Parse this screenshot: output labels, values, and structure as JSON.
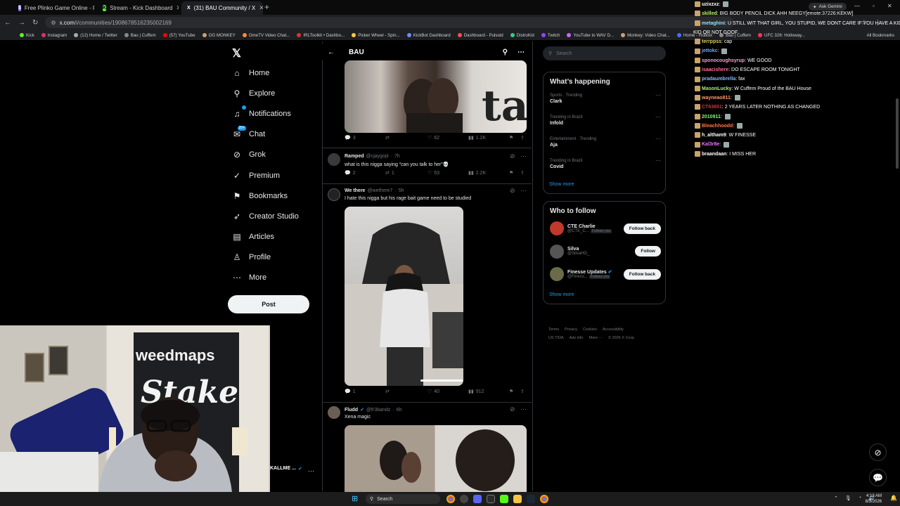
{
  "browser": {
    "tabs": [
      {
        "title": "Free Plinko Game Online - Play",
        "icon_color": "#8a6cff",
        "icon": "$"
      },
      {
        "title": "Stream - Kick Dashboard",
        "icon_color": "#53fc18",
        "icon": "K"
      },
      {
        "title": "(31) BAU Community / X",
        "icon_color": "#000000",
        "icon": "X"
      }
    ],
    "url_domain": "x.com",
    "url_path": "/i/communities/1908678516235002169",
    "bookmarks": [
      "Kick",
      "Instagram",
      "(12) Home / Twitter",
      "Bau | Cuffem",
      "(57) YouTube",
      "OG MONKEY",
      "OmeTV Video Chat...",
      "IRLToolkit • Dashbo...",
      "Picker Wheel - Spin...",
      "KickBot Dashboard",
      "Dashboard - Pulsoid",
      "DistroKid",
      "Twitch",
      "YouTube to WAV D...",
      "Monkey: Video Chat...",
      "Home - Roblox",
      "Bau | Cuffem",
      "UFC 326: Holloway..."
    ],
    "all_bookmarks": "All Bookmarks",
    "ask_gemini": "Ask Gemini"
  },
  "nav": {
    "items": [
      {
        "label": "Home",
        "icon": "home-icon",
        "glyph": "⌂"
      },
      {
        "label": "Explore",
        "icon": "search-icon",
        "glyph": "⚲"
      },
      {
        "label": "Notifications",
        "icon": "bell-icon",
        "glyph": "♫"
      },
      {
        "label": "Chat",
        "icon": "chat-icon",
        "glyph": "✉",
        "badge": "20+"
      },
      {
        "label": "Grok",
        "icon": "grok-icon",
        "glyph": "⊘"
      },
      {
        "label": "Premium",
        "icon": "premium-icon",
        "glyph": "✓"
      },
      {
        "label": "Bookmarks",
        "icon": "bookmark-icon",
        "glyph": "⚑"
      },
      {
        "label": "Creator Studio",
        "icon": "rocket-icon",
        "glyph": "➶"
      },
      {
        "label": "Articles",
        "icon": "article-icon",
        "glyph": "▤"
      },
      {
        "label": "Profile",
        "icon": "profile-icon",
        "glyph": "♙"
      },
      {
        "label": "More",
        "icon": "more-icon",
        "glyph": "⋯"
      }
    ],
    "post_label": "Post"
  },
  "feed": {
    "title": "BAU",
    "tweet0_stats": {
      "replies": "3",
      "likes": "62",
      "views": "1.2K"
    },
    "tweets": [
      {
        "name": "Ramped",
        "handle": "@cjaygojii",
        "time": "7h",
        "text": "what is this nigga saying “can you talk to her”💀",
        "replies": "2",
        "retweets": "1",
        "likes": "53",
        "views": "2.2K"
      },
      {
        "name": "We there",
        "handle": "@wethere7",
        "time": "5h",
        "text": "I hate this nigga but his rage bait game need to be studied",
        "replies": "1",
        "retweets": "",
        "likes": "40",
        "views": "912"
      },
      {
        "name": "Fludd",
        "handle": "@fr3bandz",
        "time": "6h",
        "text": "Xena magic"
      }
    ]
  },
  "right": {
    "search_placeholder": "Search",
    "whats_happening": "What’s happening",
    "trends": [
      {
        "context": "Sports · Trending",
        "name": "Clark"
      },
      {
        "context": "Trending in Brazil",
        "name": "Infold"
      },
      {
        "context": "Entertainment · Trending",
        "name": "Aja"
      },
      {
        "context": "Trending in Brazil",
        "name": "Covid"
      }
    ],
    "show_more": "Show more",
    "who_to_follow": "Who to follow",
    "follow": [
      {
        "name": "CTE Charlie",
        "handle": "@CTE_C...",
        "follows_you": "Follows you",
        "button": "Follow back",
        "color": "#c0392b"
      },
      {
        "name": "Silva",
        "handle": "@SilvaHG_",
        "follows_you": "",
        "button": "Follow",
        "color": "#555555"
      },
      {
        "name": "Finesse Updates",
        "handle": "@Finess...",
        "follows_you": "Follows you",
        "button": "Follow back",
        "color": "#6b6b4a"
      }
    ],
    "footer_line1": [
      "Terms",
      "Privacy",
      "Cookies",
      "Accessibility"
    ],
    "footer_line2": [
      "US TIDA",
      "Ads info",
      "More ···",
      "© 2026 X Corp."
    ]
  },
  "chat": {
    "lines": [
      {
        "user": "uzixzxz",
        "color": "#ffffff",
        "msg": "",
        "emote": true
      },
      {
        "user": "skilled",
        "color": "#b7f06c",
        "msg": "BIG BODY PENCIL DICK AHH NEEGY[emote:37226:KEKW]"
      },
      {
        "user": "metaghini",
        "color": "#8ee0ff",
        "msg": "U STILL WIT THAT GIRL, YOU STUPID, WE DONT CARE IF YOU HAVE A KID OR NOT GOOF"
      },
      {
        "user": "",
        "color": "#ffffff",
        "msg": "KID OR NOT GOOF"
      },
      {
        "user": "terrppss",
        "color": "#e0d060",
        "msg": "cap"
      },
      {
        "user": "jettokc",
        "color": "#6ea7ff",
        "msg": "",
        "emote": true
      },
      {
        "user": "sponocoughsyrup",
        "color": "#ff9ad5",
        "msg": "WE GOOD"
      },
      {
        "user": "isaacishere",
        "color": "#ff6b9a",
        "msg": "DO ESCAPE ROOM TONIGHT"
      },
      {
        "user": "pradaumbrella",
        "color": "#8ab4ff",
        "msg": "fax"
      },
      {
        "user": "MasonLucky",
        "color": "#a8f07a",
        "msg": "W Cuffem Proud of the BAU House"
      },
      {
        "user": "wayneao811",
        "color": "#ff9a6b",
        "msg": "",
        "emote": true
      },
      {
        "user": "CT63651",
        "color": "#d0313f",
        "msg": "2 YEARS LATER NOTHING AS CHANGED"
      },
      {
        "user": "2010911",
        "color": "#7cfc6b",
        "msg": "",
        "emote": true
      },
      {
        "user": "Bleachhoodd",
        "color": "#ff7a4d",
        "msg": "",
        "emote": true
      },
      {
        "user": "h_altham9",
        "color": "#ffffff",
        "msg": "W FINESSE"
      },
      {
        "user": "Kal3r8e",
        "color": "#e878ff",
        "msg": "",
        "emote": true
      },
      {
        "user": "braandaan",
        "color": "#ffffff",
        "msg": "I MISS HER"
      }
    ]
  },
  "webcam": {
    "caption": "KALLME ..."
  },
  "taskbar": {
    "search": "Search",
    "time": "4:13 AM",
    "date": "8/3/2026"
  }
}
